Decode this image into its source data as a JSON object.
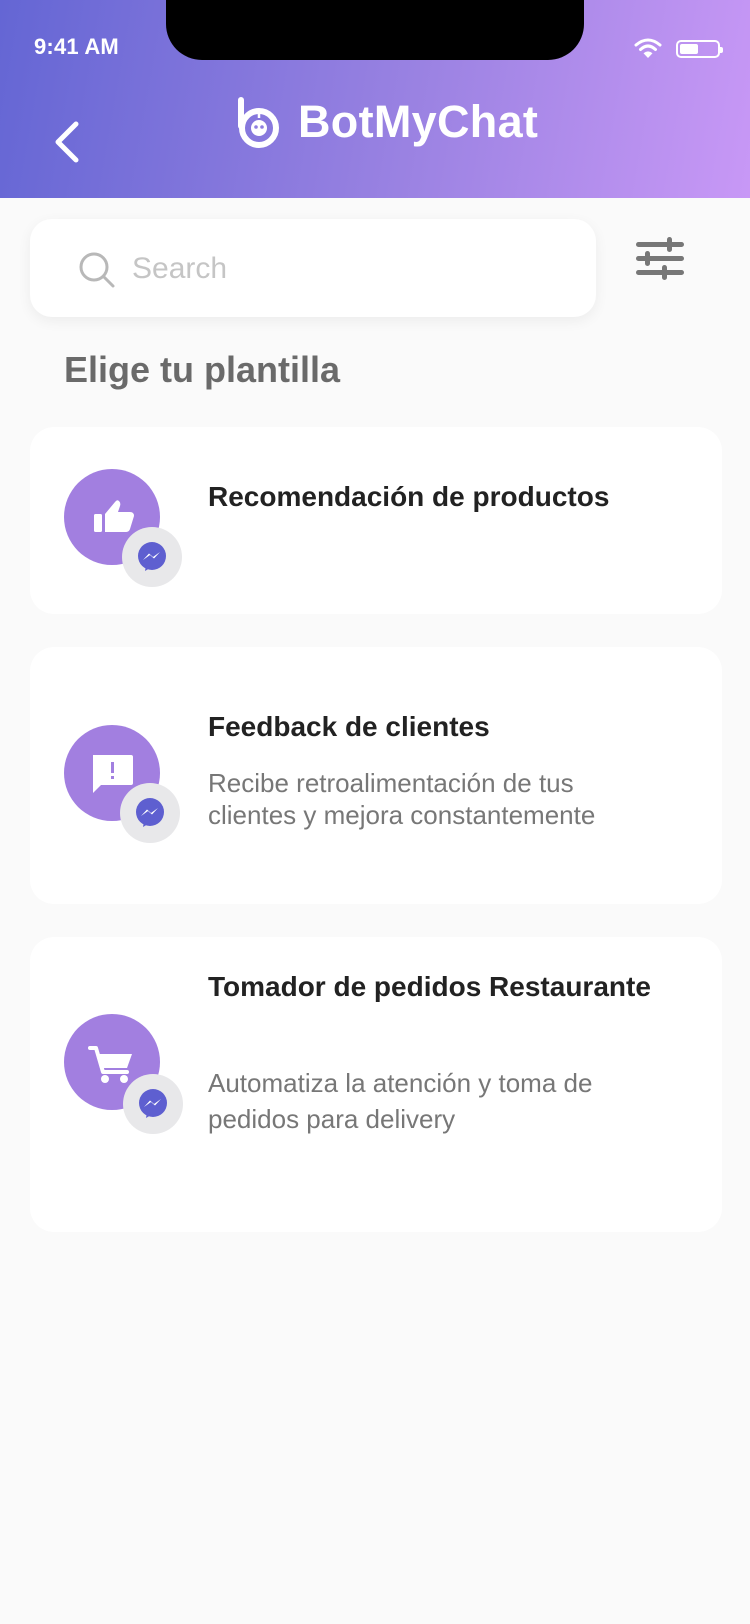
{
  "status_bar": {
    "time": "9:41 AM",
    "battery_level": 0.45
  },
  "header": {
    "brand": "BotMyChat",
    "back_icon": "chevron-left-icon",
    "logo_icon": "bot-logo-icon"
  },
  "search": {
    "placeholder": "Search",
    "value": "",
    "icon": "search-icon"
  },
  "filter": {
    "icon": "sliders-icon"
  },
  "section_title": "Elige tu plantilla",
  "colors": {
    "header_start": "#6466d4",
    "header_end": "#c898f6",
    "accent": "#a27fe0",
    "messenger": "#5e5fd0"
  },
  "templates": [
    {
      "title": "Recomendación de productos",
      "description": "",
      "icon": "thumbs-up-icon",
      "channel_icon": "messenger-icon"
    },
    {
      "title": "Feedback de clientes",
      "description": "Recibe retroalimentación de tus clientes y mejora constantemente",
      "icon": "feedback-icon",
      "channel_icon": "messenger-icon"
    },
    {
      "title": "Tomador de pedidos Restaurante",
      "description": "Automatiza la atención y toma de pedidos para delivery",
      "icon": "cart-icon",
      "channel_icon": "messenger-icon"
    }
  ]
}
